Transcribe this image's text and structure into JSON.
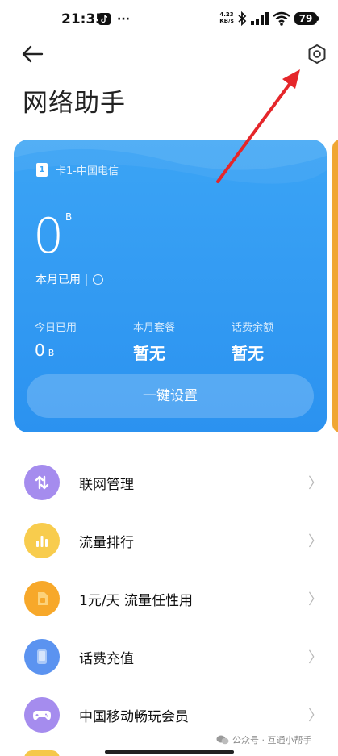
{
  "status_bar": {
    "time": "21:35",
    "net_speed_value": "4.23",
    "net_speed_unit": "KB/s",
    "battery": "79",
    "dots": "···"
  },
  "header": {
    "title": "网络助手",
    "back_icon": "arrow-left-icon",
    "settings_icon": "gear-icon"
  },
  "card": {
    "sim_badge": "1",
    "sim_label": "卡1-中国电信",
    "usage_value": "0",
    "usage_unit": "B",
    "usage_label": "本月已用 |",
    "stats": [
      {
        "label": "今日已用",
        "value": "0",
        "unit": "B"
      },
      {
        "label": "本月套餐",
        "value": "暂无"
      },
      {
        "label": "话费余额",
        "value": "暂无"
      }
    ],
    "setup_button": "一键设置",
    "color": "#3ba4f5"
  },
  "menu": [
    {
      "label": "联网管理",
      "icon": "up-down-arrows-icon",
      "color": "#9b7fe6"
    },
    {
      "label": "流量排行",
      "icon": "bar-chart-icon",
      "color": "#f7c844"
    },
    {
      "label": "1元/天 流量任性用",
      "icon": "sim-card-icon",
      "color": "#f5a623"
    },
    {
      "label": "话费充值",
      "icon": "phone-icon",
      "color": "#4f8ef0"
    },
    {
      "label": "中国移动畅玩会员",
      "icon": "gamepad-icon",
      "color": "#9b7fe6"
    }
  ],
  "watermark": "公众号 · 互通小帮手"
}
